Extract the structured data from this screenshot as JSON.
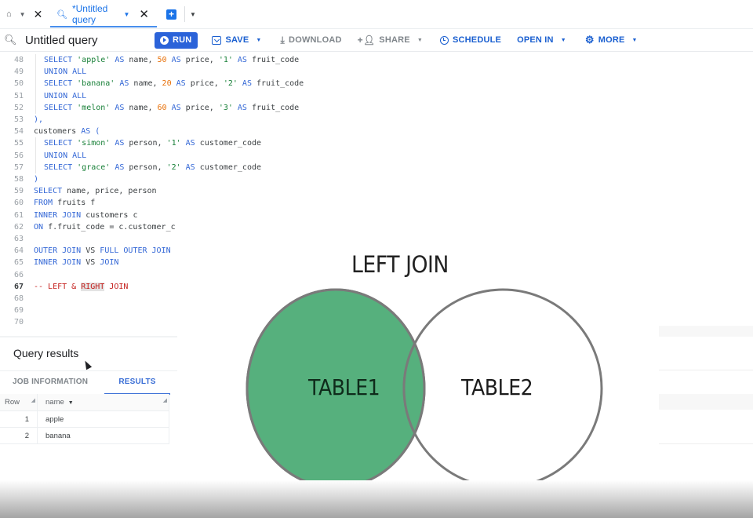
{
  "tabs": {
    "home_icon": "home-icon",
    "active_tab_label": "*Untitled query",
    "new_tab_icon": "plus-icon"
  },
  "toolbar": {
    "title": "Untitled query",
    "run_label": "RUN",
    "save_label": "SAVE",
    "download_label": "DOWNLOAD",
    "share_label": "SHARE",
    "schedule_label": "SCHEDULE",
    "open_in_label": "OPEN IN",
    "more_label": "MORE"
  },
  "editor": {
    "active_line": 67,
    "lines": [
      {
        "n": "48",
        "indent": true,
        "tokens": [
          [
            "kw",
            "SELECT "
          ],
          [
            "str",
            "'apple'"
          ],
          [
            "kw",
            " AS "
          ],
          [
            "id",
            "name, "
          ],
          [
            "num",
            "50"
          ],
          [
            "kw",
            " AS "
          ],
          [
            "id",
            "price, "
          ],
          [
            "str",
            "'1'"
          ],
          [
            "kw",
            " AS "
          ],
          [
            "id",
            "fruit_code"
          ]
        ]
      },
      {
        "n": "49",
        "indent": true,
        "tokens": [
          [
            "kw",
            "UNION ALL"
          ]
        ]
      },
      {
        "n": "50",
        "indent": true,
        "tokens": [
          [
            "kw",
            "SELECT "
          ],
          [
            "str",
            "'banana'"
          ],
          [
            "kw",
            " AS "
          ],
          [
            "id",
            "name, "
          ],
          [
            "num",
            "20"
          ],
          [
            "kw",
            " AS "
          ],
          [
            "id",
            "price, "
          ],
          [
            "str",
            "'2'"
          ],
          [
            "kw",
            " AS "
          ],
          [
            "id",
            "fruit_code"
          ]
        ]
      },
      {
        "n": "51",
        "indent": true,
        "tokens": [
          [
            "kw",
            "UNION ALL"
          ]
        ]
      },
      {
        "n": "52",
        "indent": true,
        "tokens": [
          [
            "kw",
            "SELECT "
          ],
          [
            "str",
            "'melon'"
          ],
          [
            "kw",
            " AS "
          ],
          [
            "id",
            "name, "
          ],
          [
            "num",
            "60"
          ],
          [
            "kw",
            " AS "
          ],
          [
            "id",
            "price, "
          ],
          [
            "str",
            "'3'"
          ],
          [
            "kw",
            " AS "
          ],
          [
            "id",
            "fruit_code"
          ]
        ]
      },
      {
        "n": "53",
        "indent": false,
        "tokens": [
          [
            "kw",
            "),"
          ]
        ]
      },
      {
        "n": "54",
        "indent": false,
        "tokens": [
          [
            "id",
            "customers "
          ],
          [
            "kw",
            "AS ("
          ]
        ]
      },
      {
        "n": "55",
        "indent": true,
        "tokens": [
          [
            "kw",
            "SELECT "
          ],
          [
            "str",
            "'simon'"
          ],
          [
            "kw",
            " AS "
          ],
          [
            "id",
            "person, "
          ],
          [
            "str",
            "'1'"
          ],
          [
            "kw",
            " AS "
          ],
          [
            "id",
            "customer_code"
          ]
        ]
      },
      {
        "n": "56",
        "indent": true,
        "tokens": [
          [
            "kw",
            "UNION ALL"
          ]
        ]
      },
      {
        "n": "57",
        "indent": true,
        "tokens": [
          [
            "kw",
            "SELECT "
          ],
          [
            "str",
            "'grace'"
          ],
          [
            "kw",
            " AS "
          ],
          [
            "id",
            "person, "
          ],
          [
            "str",
            "'2'"
          ],
          [
            "kw",
            " AS "
          ],
          [
            "id",
            "customer_code"
          ]
        ]
      },
      {
        "n": "58",
        "indent": false,
        "tokens": [
          [
            "kw",
            ")"
          ]
        ]
      },
      {
        "n": "59",
        "indent": false,
        "tokens": [
          [
            "kw",
            "SELECT "
          ],
          [
            "id",
            "name, price, person"
          ]
        ]
      },
      {
        "n": "60",
        "indent": false,
        "tokens": [
          [
            "kw",
            "FROM "
          ],
          [
            "id",
            "fruits f"
          ]
        ]
      },
      {
        "n": "61",
        "indent": false,
        "tokens": [
          [
            "kw",
            "INNER JOIN "
          ],
          [
            "id",
            "customers c"
          ]
        ]
      },
      {
        "n": "62",
        "indent": false,
        "tokens": [
          [
            "kw",
            "ON "
          ],
          [
            "id",
            "f.fruit_code = c.customer_c"
          ]
        ]
      },
      {
        "n": "63",
        "indent": false,
        "tokens": []
      },
      {
        "n": "64",
        "indent": false,
        "tokens": [
          [
            "kw",
            "OUTER JOIN "
          ],
          [
            "id",
            "VS "
          ],
          [
            "kw",
            "FULL OUTER JOIN"
          ]
        ]
      },
      {
        "n": "65",
        "indent": false,
        "tokens": [
          [
            "kw",
            "INNER JOIN "
          ],
          [
            "id",
            "VS "
          ],
          [
            "kw",
            "JOIN"
          ]
        ]
      },
      {
        "n": "66",
        "indent": false,
        "tokens": []
      },
      {
        "n": "67",
        "indent": false,
        "tokens": [
          [
            "cmt",
            "-- LEFT & "
          ],
          [
            "cmt hl",
            "RIGHT"
          ],
          [
            "cmt",
            " JOIN"
          ]
        ]
      },
      {
        "n": "68",
        "indent": false,
        "tokens": []
      },
      {
        "n": "69",
        "indent": false,
        "tokens": []
      },
      {
        "n": "70",
        "indent": false,
        "tokens": []
      }
    ]
  },
  "results": {
    "title": "Query results",
    "tabs": [
      "JOB INFORMATION",
      "RESULTS"
    ],
    "active_tab": "RESULTS",
    "columns": [
      "Row",
      "name"
    ],
    "rows": [
      {
        "row": "1",
        "name": "apple"
      },
      {
        "row": "2",
        "name": "banana"
      }
    ]
  },
  "venn": {
    "title": "LEFT JOIN",
    "left_label": "TABLE1",
    "right_label": "TABLE2",
    "highlight": "left",
    "fill_color": "#56b07d",
    "stroke_color": "#7a7a7a"
  }
}
